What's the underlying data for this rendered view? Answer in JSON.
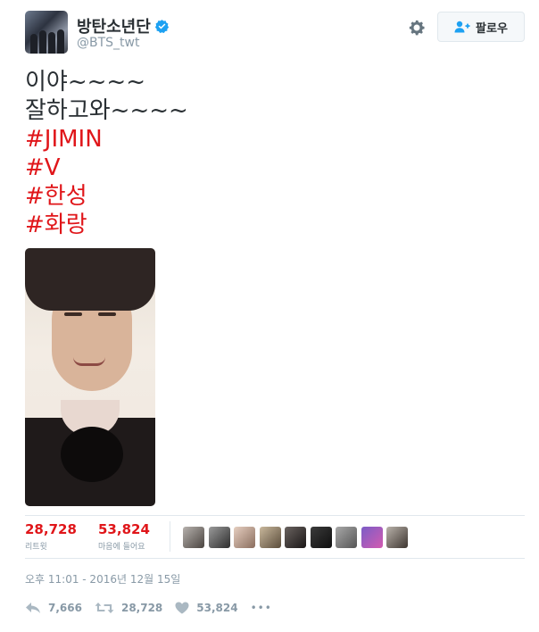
{
  "header": {
    "display_name": "방탄소년단",
    "handle": "@BTS_twt",
    "follow_label": "팔로우",
    "verified_icon": "verified-badge-icon",
    "gear_icon": "gear-icon"
  },
  "tweet": {
    "lines": [
      {
        "text": "이야~~~~",
        "kind": "plain"
      },
      {
        "text": "잘하고와~~~~",
        "kind": "plain"
      },
      {
        "text": "#JIMIN",
        "kind": "hashtag"
      },
      {
        "text": "#V",
        "kind": "hashtag"
      },
      {
        "text": "#한성",
        "kind": "hashtag"
      },
      {
        "text": "#화랑",
        "kind": "hashtag"
      }
    ]
  },
  "stats": {
    "retweets": {
      "value": "28,728",
      "label": "리트윗"
    },
    "likes": {
      "value": "53,824",
      "label": "마음에 들어요"
    }
  },
  "timestamp": "오후 11:01 - 2016년 12월 15일",
  "actions": {
    "reply_count": "7,666",
    "retweet_count": "28,728",
    "like_count": "53,824",
    "more_label": "•••"
  },
  "colors": {
    "accent": "#e0161a",
    "muted": "#8899a6",
    "text": "#292f33",
    "verified": "#1da1f2"
  }
}
